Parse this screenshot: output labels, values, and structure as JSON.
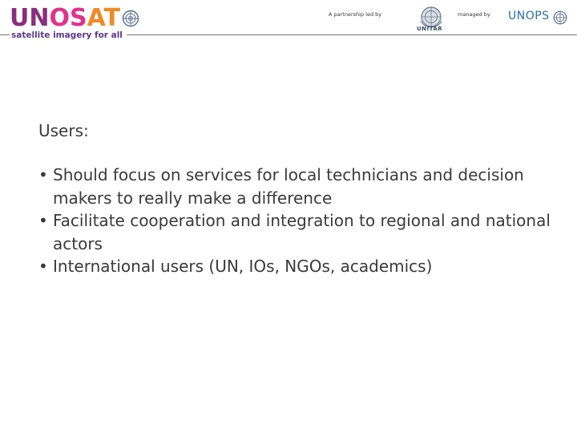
{
  "header": {
    "logo": {
      "part1": "UN",
      "part2": "OS",
      "part3": "AT",
      "tagline": "satellite imagery for all"
    },
    "partnership_text": "A partnership led by",
    "unitar_label": "UNITAR",
    "managed_text": "managed by",
    "unops_label": "UNOPS"
  },
  "content": {
    "heading": "Users:",
    "bullets": [
      "Should focus on services for local technicians and decision makers to really make a difference",
      "Facilitate cooperation and integration to regional and national actors",
      "International users (UN, IOs, NGOs, academics)"
    ]
  },
  "colors": {
    "logo_purple": "#8a2d7f",
    "logo_pink": "#e0338a",
    "logo_orange": "#f08a24",
    "unops_blue": "#2d6fa8"
  },
  "icons": [
    "un-globe-icon",
    "unitar-emblem-icon",
    "bullet-icon"
  ]
}
